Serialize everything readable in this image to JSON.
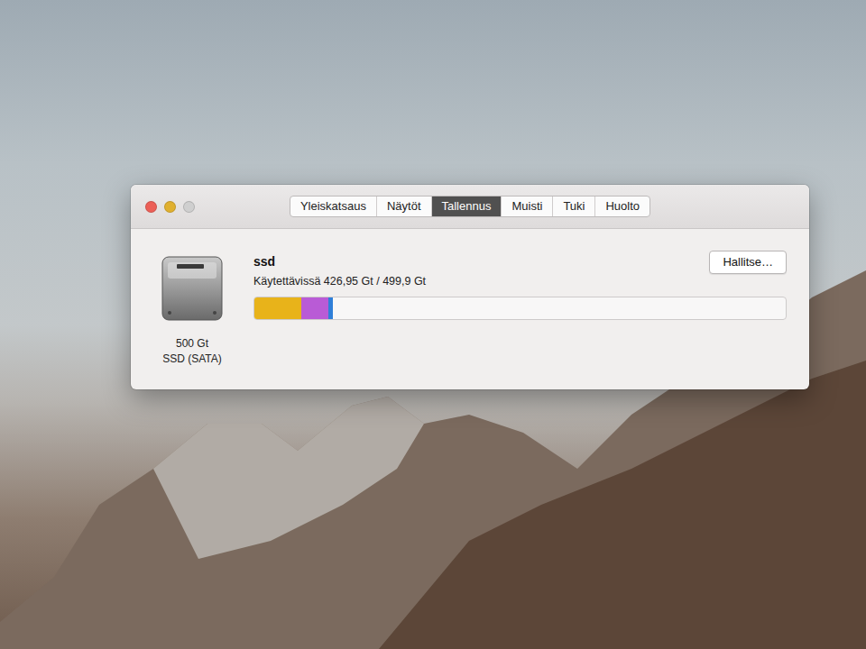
{
  "window": {
    "buttons": [
      {
        "color": "#ec5f57"
      },
      {
        "color": "#e0b02f"
      },
      {
        "color": "#cfcfcf"
      }
    ]
  },
  "tabs": [
    {
      "label": "Yleiskatsaus",
      "selected": false
    },
    {
      "label": "Näytöt",
      "selected": false
    },
    {
      "label": "Tallennus",
      "selected": true
    },
    {
      "label": "Muisti",
      "selected": false
    },
    {
      "label": "Tuki",
      "selected": false
    },
    {
      "label": "Huolto",
      "selected": false
    }
  ],
  "disk": {
    "name": "ssd",
    "available": "Käytettävissä 426,95 Gt / 499,9 Gt",
    "capacity": "500 Gt",
    "type": "SSD (SATA)",
    "manage_button": "Hallitse…",
    "segments": [
      {
        "level": 0.088,
        "color": "#e8b31a"
      },
      {
        "level": 0.051,
        "color": "#b95bd6"
      },
      {
        "level": 0.009,
        "color": "#2f7fd8"
      }
    ]
  }
}
